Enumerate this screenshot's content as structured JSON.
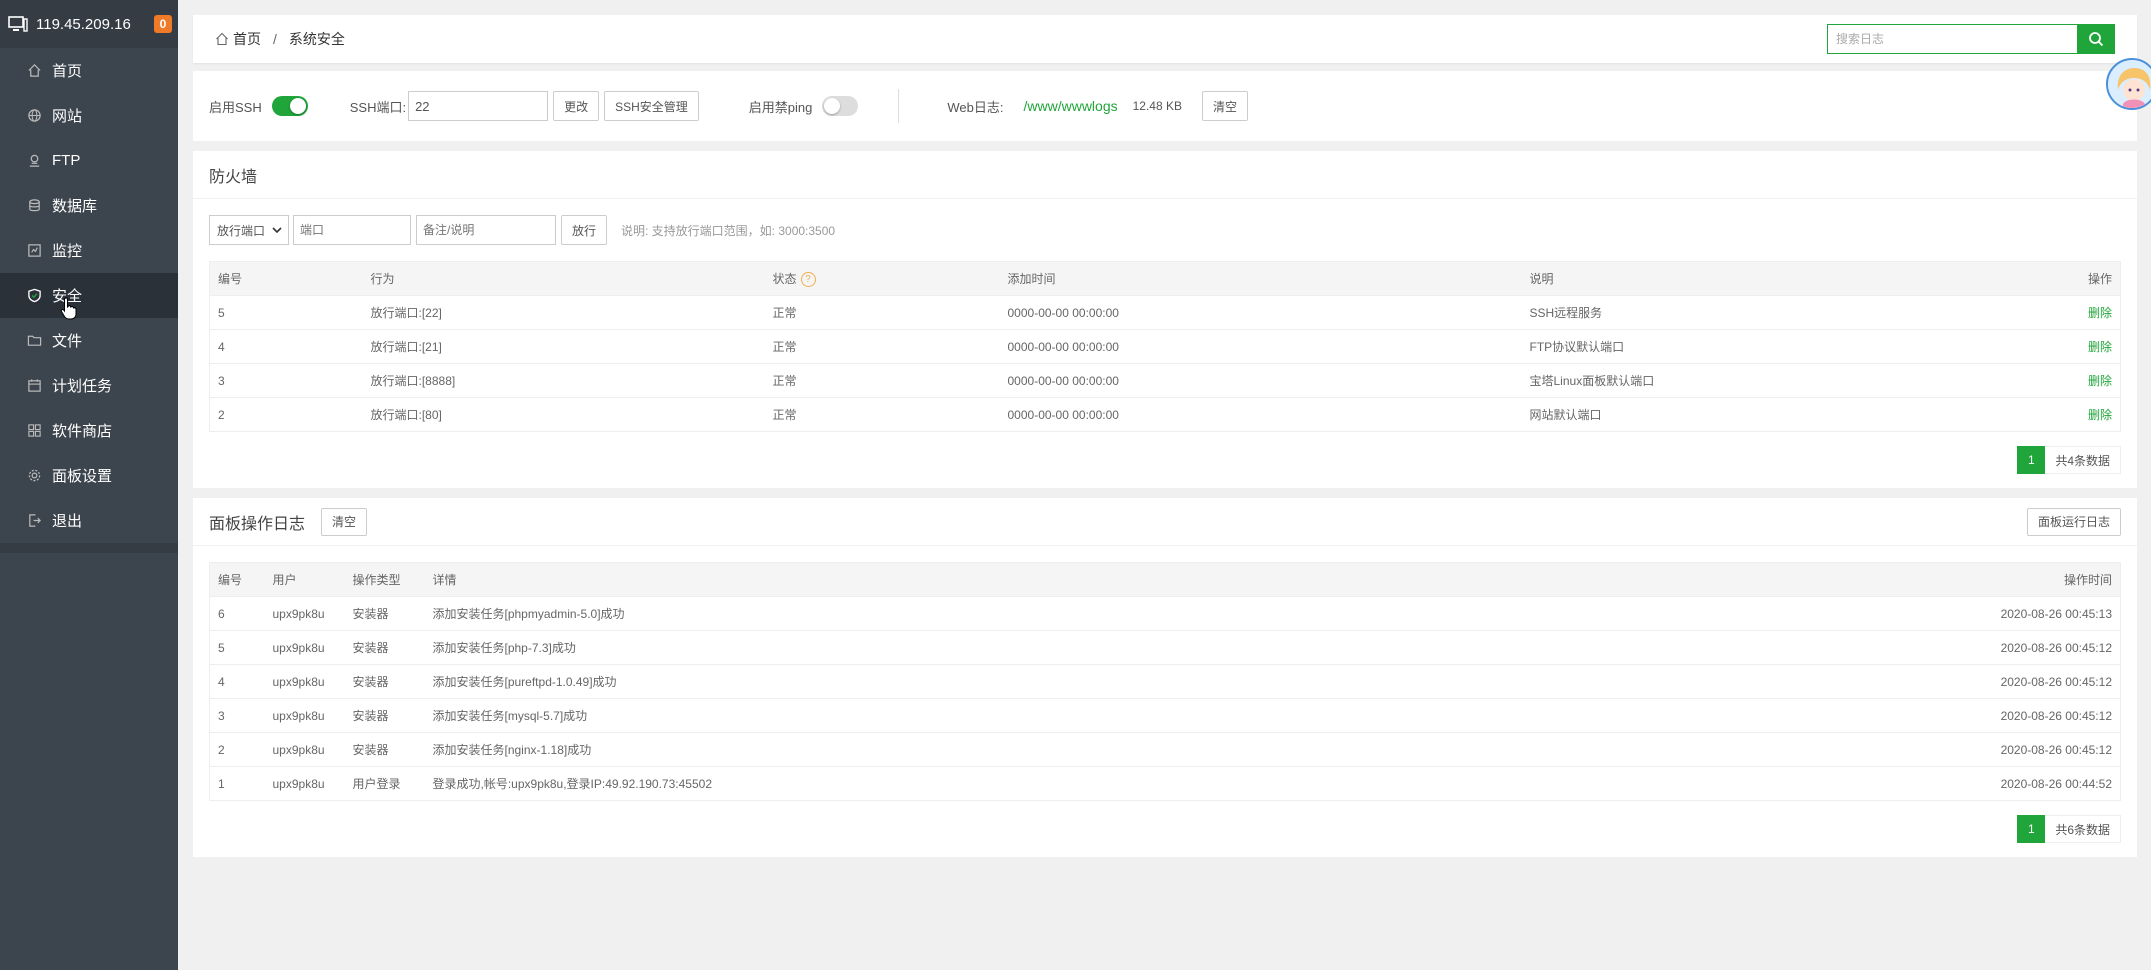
{
  "sidebar": {
    "server_ip": "119.45.209.16",
    "badge_count": "0",
    "items": [
      {
        "label": "首页",
        "icon": "home-icon"
      },
      {
        "label": "网站",
        "icon": "globe-icon"
      },
      {
        "label": "FTP",
        "icon": "ftp-icon"
      },
      {
        "label": "数据库",
        "icon": "database-icon"
      },
      {
        "label": "监控",
        "icon": "monitor-icon"
      },
      {
        "label": "安全",
        "icon": "shield-icon",
        "active": true
      },
      {
        "label": "文件",
        "icon": "folder-icon"
      },
      {
        "label": "计划任务",
        "icon": "calendar-icon"
      },
      {
        "label": "软件商店",
        "icon": "apps-icon"
      },
      {
        "label": "面板设置",
        "icon": "gear-icon"
      },
      {
        "label": "退出",
        "icon": "logout-icon"
      }
    ]
  },
  "breadcrumb": {
    "home": "首页",
    "separator": "/",
    "current": "系统安全"
  },
  "search": {
    "placeholder": "搜索日志"
  },
  "settings": {
    "ssh_label": "启用SSH",
    "ssh_enabled": true,
    "ssh_port_label": "SSH端口:",
    "ssh_port_value": "22",
    "change_button": "更改",
    "ssh_manage_button": "SSH安全管理",
    "ping_label": "启用禁ping",
    "ping_enabled": false,
    "weblog_label": "Web日志:",
    "weblog_path": "/www/wwwlogs",
    "weblog_size": "12.48 KB",
    "clear_button": "清空"
  },
  "firewall": {
    "title": "防火墙",
    "select_value": "放行端口",
    "port_placeholder": "端口",
    "note_placeholder": "备注/说明",
    "allow_button": "放行",
    "hint": "说明: 支持放行端口范围，如: 3000:3500",
    "headers": [
      "编号",
      "行为",
      "状态",
      "添加时间",
      "说明",
      "操作"
    ],
    "rows": [
      {
        "id": "5",
        "action": "放行端口:[22]",
        "status": "正常",
        "time": "0000-00-00 00:00:00",
        "note": "SSH远程服务",
        "op": "删除"
      },
      {
        "id": "4",
        "action": "放行端口:[21]",
        "status": "正常",
        "time": "0000-00-00 00:00:00",
        "note": "FTP协议默认端口",
        "op": "删除"
      },
      {
        "id": "3",
        "action": "放行端口:[8888]",
        "status": "正常",
        "time": "0000-00-00 00:00:00",
        "note": "宝塔Linux面板默认端口",
        "op": "删除"
      },
      {
        "id": "2",
        "action": "放行端口:[80]",
        "status": "正常",
        "time": "0000-00-00 00:00:00",
        "note": "网站默认端口",
        "op": "删除"
      }
    ],
    "page": "1",
    "total": "共4条数据"
  },
  "logs": {
    "title": "面板操作日志",
    "clear_button": "清空",
    "run_log_button": "面板运行日志",
    "headers": [
      "编号",
      "用户",
      "操作类型",
      "详情",
      "操作时间"
    ],
    "rows": [
      {
        "id": "6",
        "user": "upx9pk8u",
        "type": "安装器",
        "detail": "添加安装任务[phpmyadmin-5.0]成功",
        "time": "2020-08-26 00:45:13"
      },
      {
        "id": "5",
        "user": "upx9pk8u",
        "type": "安装器",
        "detail": "添加安装任务[php-7.3]成功",
        "time": "2020-08-26 00:45:12"
      },
      {
        "id": "4",
        "user": "upx9pk8u",
        "type": "安装器",
        "detail": "添加安装任务[pureftpd-1.0.49]成功",
        "time": "2020-08-26 00:45:12"
      },
      {
        "id": "3",
        "user": "upx9pk8u",
        "type": "安装器",
        "detail": "添加安装任务[mysql-5.7]成功",
        "time": "2020-08-26 00:45:12"
      },
      {
        "id": "2",
        "user": "upx9pk8u",
        "type": "安装器",
        "detail": "添加安装任务[nginx-1.18]成功",
        "time": "2020-08-26 00:45:12"
      },
      {
        "id": "1",
        "user": "upx9pk8u",
        "type": "用户登录",
        "detail": "登录成功,帐号:upx9pk8u,登录IP:49.92.190.73:45502",
        "time": "2020-08-26 00:44:52"
      }
    ],
    "page": "1",
    "total": "共6条数据"
  },
  "colors": {
    "accent": "#20a53a",
    "sidebar": "#3c444d",
    "badge": "#ef7b28"
  }
}
